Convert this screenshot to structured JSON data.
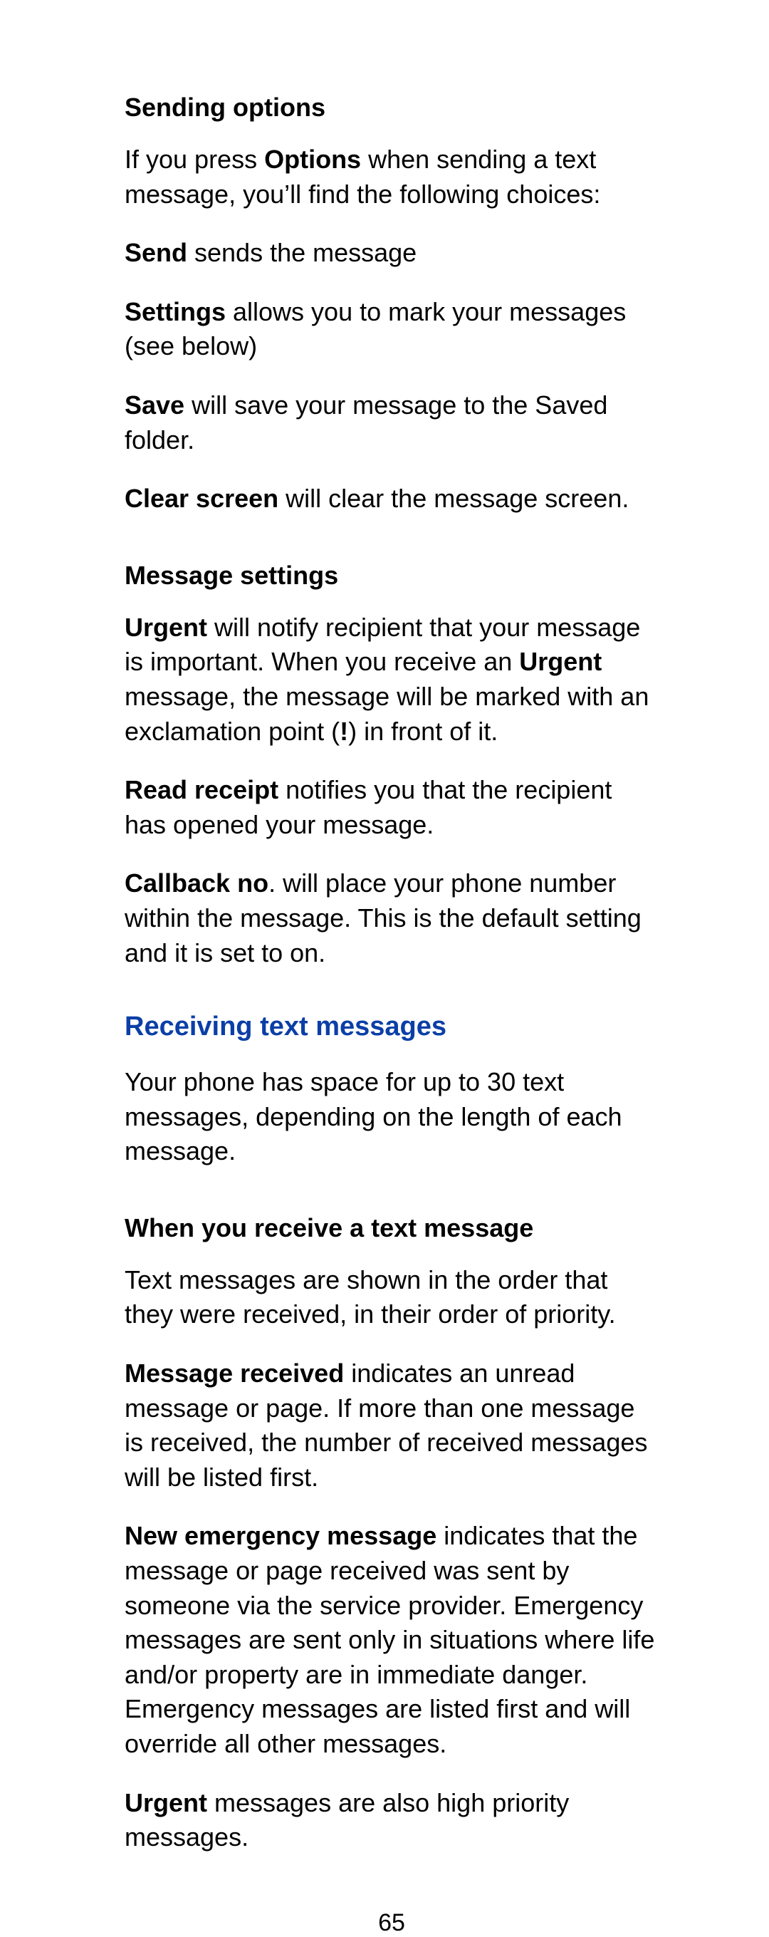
{
  "sending_options": {
    "heading": "Sending options",
    "intro_pre": "If you press ",
    "intro_bold": "Options",
    "intro_post": " when sending a text message, you’ll find the following choices:",
    "send_bold": "Send",
    "send_rest": " sends the message",
    "settings_bold": "Settings",
    "settings_rest": " allows you to mark your messages (see below)",
    "save_bold": "Save",
    "save_rest": " will save your message to the Saved folder.",
    "clear_bold": "Clear screen",
    "clear_rest": " will clear the message screen."
  },
  "message_settings": {
    "heading": "Message settings",
    "urgent_bold1": "Urgent",
    "urgent_mid1": " will notify recipient that your message is important. When you receive an ",
    "urgent_bold2": "Urgent",
    "urgent_mid2": " message, the message will be marked with an exclamation point (",
    "urgent_bold3": "!",
    "urgent_end": ") in front of it.",
    "read_bold": "Read receipt",
    "read_rest": " notifies you that the recipient has opened your message.",
    "callback_bold": "Callback no",
    "callback_rest": ". will place your phone number within the message. This is the default setting and it is set to on."
  },
  "receiving": {
    "title": "Receiving text messages",
    "intro": " Your phone has space for up to 30 text messages, depending on the length of each message.",
    "when_heading": "When you receive a text message",
    "order_para": "Text messages are shown in the order that they were received, in their order of priority.",
    "msg_recv_bold": "Message received",
    "msg_recv_rest": " indicates an unread message or page. If more than one message is received, the number of received messages will be listed first.",
    "emerg_bold": "New emergency message",
    "emerg_rest": " indicates that the message or page received was sent by someone via the service provider. Emergency messages are sent only in situations where life and/or property are in immediate danger. Emergency messages are listed first and will override all other messages.",
    "urgent_bold": "Urgent",
    "urgent_rest": " messages are also high priority messages."
  },
  "page_number": "65"
}
